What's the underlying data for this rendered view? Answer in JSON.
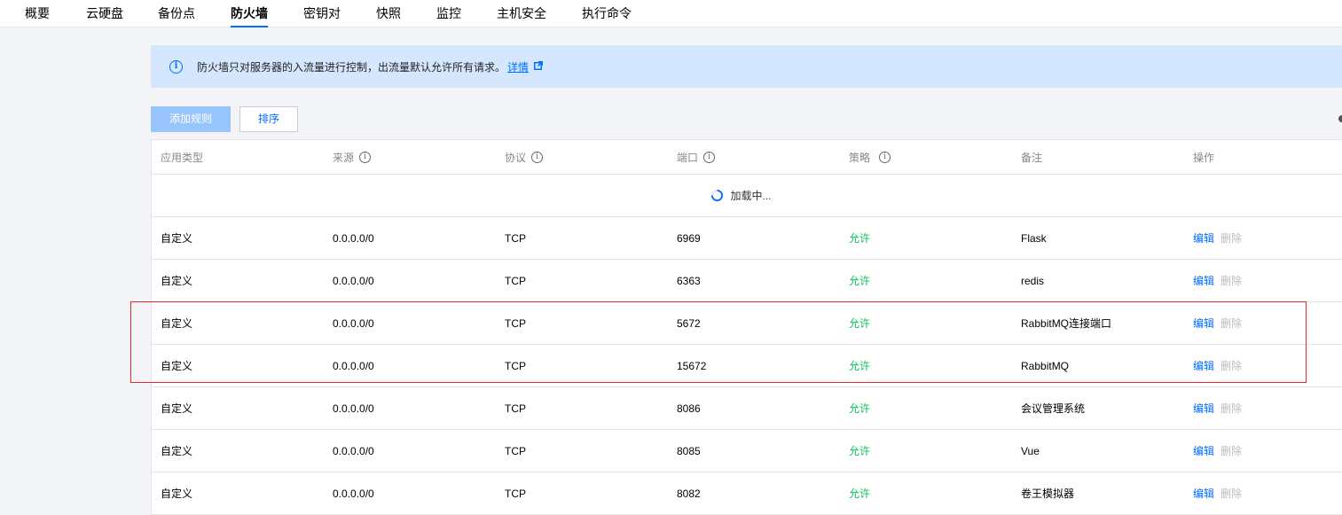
{
  "tabs": [
    {
      "label": "概要",
      "active": false
    },
    {
      "label": "云硬盘",
      "active": false
    },
    {
      "label": "备份点",
      "active": false
    },
    {
      "label": "防火墙",
      "active": true
    },
    {
      "label": "密钥对",
      "active": false
    },
    {
      "label": "快照",
      "active": false
    },
    {
      "label": "监控",
      "active": false
    },
    {
      "label": "主机安全",
      "active": false
    },
    {
      "label": "执行命令",
      "active": false
    }
  ],
  "notice": {
    "text": "防火墙只对服务器的入流量进行控制，出流量默认允许所有请求。",
    "link": "详情"
  },
  "toolbar": {
    "add_label": "添加规则",
    "sort_label": "排序"
  },
  "table": {
    "headers": [
      "应用类型",
      "来源",
      "协议",
      "端口",
      "策略",
      "备注",
      "操作"
    ],
    "loading_text": "加载中...",
    "action_edit": "编辑",
    "action_delete": "删除",
    "rows": [
      {
        "type": "自定义",
        "source": "0.0.0.0/0",
        "protocol": "TCP",
        "port": "6969",
        "policy": "允许",
        "note": "Flask"
      },
      {
        "type": "自定义",
        "source": "0.0.0.0/0",
        "protocol": "TCP",
        "port": "6363",
        "policy": "允许",
        "note": "redis"
      },
      {
        "type": "自定义",
        "source": "0.0.0.0/0",
        "protocol": "TCP",
        "port": "5672",
        "policy": "允许",
        "note": "RabbitMQ连接端口"
      },
      {
        "type": "自定义",
        "source": "0.0.0.0/0",
        "protocol": "TCP",
        "port": "15672",
        "policy": "允许",
        "note": "RabbitMQ"
      },
      {
        "type": "自定义",
        "source": "0.0.0.0/0",
        "protocol": "TCP",
        "port": "8086",
        "policy": "允许",
        "note": "会议管理系统"
      },
      {
        "type": "自定义",
        "source": "0.0.0.0/0",
        "protocol": "TCP",
        "port": "8085",
        "policy": "允许",
        "note": "Vue"
      },
      {
        "type": "自定义",
        "source": "0.0.0.0/0",
        "protocol": "TCP",
        "port": "8082",
        "policy": "允许",
        "note": "卷王模拟器"
      }
    ]
  },
  "icons": {
    "info": "info-circle-icon",
    "external": "external-link-icon",
    "help": "question-circle-icon",
    "loading": "spinner-icon"
  },
  "colors": {
    "accent": "#006eff",
    "allow": "#0abf5b",
    "highlight": "#e32b2b",
    "notice_bg": "#d5e7ff"
  }
}
